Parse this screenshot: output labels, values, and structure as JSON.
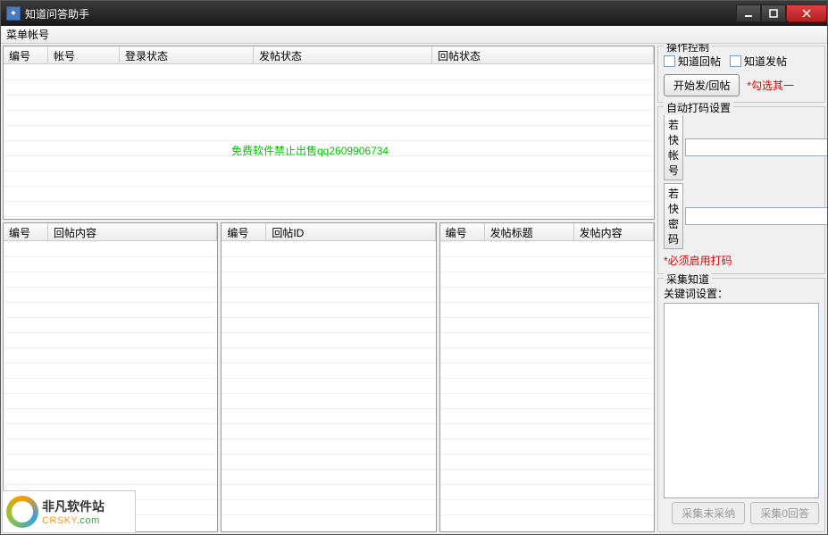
{
  "window": {
    "title": "知道问答助手"
  },
  "menubar": {
    "item": "菜单帐号"
  },
  "topGrid": {
    "cols": [
      "编号",
      "帐号",
      "登录状态",
      "发帖状态",
      "回帖状态"
    ],
    "widths": [
      50,
      80,
      150,
      200,
      200
    ],
    "watermark": "免费软件禁止出售qq2609906734"
  },
  "bottomGrid1": {
    "cols": [
      "编号",
      "回帖内容"
    ],
    "widths": [
      50,
      160
    ]
  },
  "bottomGrid2": {
    "cols": [
      "编号",
      "回帖ID"
    ],
    "widths": [
      50,
      160
    ]
  },
  "bottomGrid3": {
    "cols": [
      "编号",
      "发帖标题",
      "发帖内容"
    ],
    "widths": [
      50,
      100,
      100
    ]
  },
  "ops": {
    "title": "操作控制",
    "chk1": "知道回帖",
    "chk2": "知道发帖",
    "btn": "开始发/回帖",
    "note": "*勾选其一"
  },
  "dama": {
    "title": "自动打码设置",
    "acctLabel": "若快帐号",
    "pwdLabel": "若快密码",
    "note": "*必须启用打码"
  },
  "collect": {
    "title": "采集知道",
    "kwLabel": "关键词设置：",
    "btn1": "采集未采纳",
    "btn2": "采集0回答"
  },
  "logo": {
    "cn": "非凡软件站",
    "en1": "CRSKY",
    "en2": ".com"
  }
}
